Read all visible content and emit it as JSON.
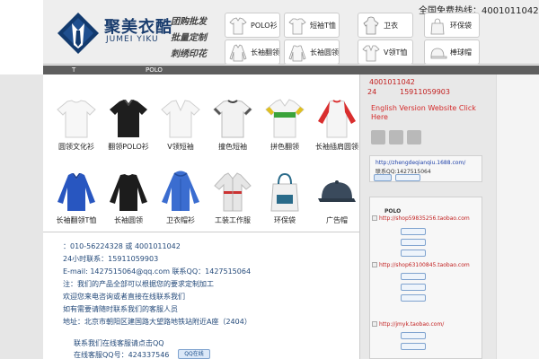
{
  "header": {
    "hotline": "全国免费热线：4001011042",
    "brand_cn": "聚美衣酷",
    "brand_en": "JUMEI YIKU",
    "slogan": [
      "团购批发",
      "批量定制",
      "刺绣印花"
    ],
    "categories": [
      {
        "label": "POLO衫",
        "icon": "polo-shirt-icon"
      },
      {
        "label": "短袖T恤",
        "icon": "tshirt-icon"
      },
      {
        "label": "卫衣",
        "icon": "hoodie-icon"
      },
      {
        "label": "环保袋",
        "icon": "tote-bag-icon"
      },
      {
        "label": "长袖翻领",
        "icon": "long-sleeve-polo-icon"
      },
      {
        "label": "长袖圆领",
        "icon": "long-sleeve-tee-icon"
      },
      {
        "label": "V领T恤",
        "icon": "vneck-tee-icon"
      },
      {
        "label": "棒球帽",
        "icon": "baseball-cap-icon"
      }
    ]
  },
  "nav": {
    "items": [
      "T",
      "POLO"
    ]
  },
  "products": [
    {
      "label": "圆领文化衫",
      "color": "#f4f4f4"
    },
    {
      "label": "翻领POLO衫",
      "color": "#1e1e1e"
    },
    {
      "label": "V领短袖",
      "color": "#f6f6f6"
    },
    {
      "label": "撞色短袖",
      "color": "#f2f2f2"
    },
    {
      "label": "拼色翻领",
      "color": "#f5f5f5"
    },
    {
      "label": "长袖插肩圆领",
      "color": "#f5f5f5"
    },
    {
      "label": "长袖翻领T恤",
      "color": "#2856c0"
    },
    {
      "label": "长袖圆领",
      "color": "#1c1c1c"
    },
    {
      "label": "卫衣帽衫",
      "color": "#3b6dd0"
    },
    {
      "label": "工装工作服",
      "color": "#e6e6e6"
    },
    {
      "label": "环保袋",
      "color": "#f0f0f0"
    },
    {
      "label": "广告帽",
      "color": "#3a4a5c"
    }
  ],
  "contact": {
    "lines": [
      "：010-56224328 或 4001011042",
      "24小时联系：15911059903",
      "E-mail: 1427515064@qq.com 联系QQ：1427515064",
      "注：我们的产品全部可以根据您的要求定制加工",
      "欢迎您来电咨询或者直接在线联系我们",
      "如有需要请随时联系我们的客服人员",
      "地址：北京市朝阳区建国路大望路地铁站附近A座（2404）",
      "联系我们在线客服请点击QQ",
      "在线客服QQ号：424337546"
    ],
    "qq_label": "QQ在线"
  },
  "right": {
    "phone1": "4001011042",
    "phone2_prefix": "24",
    "phone2": "15911059903",
    "english_link": "English Version Website Click Here",
    "box1": {
      "link": "http://zhengdeqianqiu.1688.com/",
      "qq": "联系QQ:1427515064"
    },
    "section_title": "POLO",
    "shop_links": [
      "http://shop59835256.taobao.com",
      "http://shop63100845.taobao.com",
      "http://jmyk.taobao.com/"
    ],
    "colors": {
      "accent": "#c21f1f",
      "link": "#1c3fa8"
    }
  }
}
